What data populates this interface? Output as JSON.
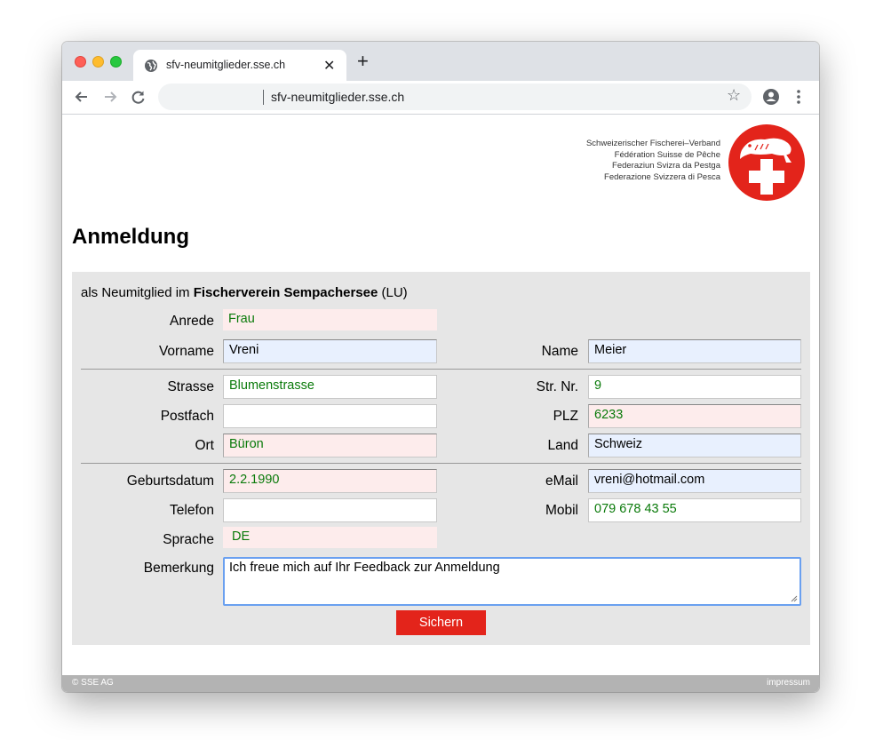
{
  "browser": {
    "tab_title": "sfv-neumitglieder.sse.ch",
    "url": "sfv-neumitglieder.sse.ch",
    "new_tab": "+",
    "close_tab": "✕"
  },
  "brand": {
    "line1": "Schweizerischer Fischerei–Verband",
    "line2": "Fédération Suisse de Pêche",
    "line3": "Federaziun Svizra da Pestga",
    "line4": "Federazione Svizzera di Pesca",
    "logo_color": "#e3241b"
  },
  "page": {
    "title": "Anmeldung",
    "intro_prefix": "als Neumitglied im ",
    "club": "Fischerverein Sempachersee",
    "intro_suffix": " (LU)"
  },
  "form": {
    "anrede_label": "Anrede",
    "anrede_value": "Frau",
    "vorname_label": "Vorname",
    "vorname_value": "Vreni",
    "name_label": "Name",
    "name_value": "Meier",
    "strasse_label": "Strasse",
    "strasse_value": "Blumenstrasse",
    "strnr_label": "Str. Nr.",
    "strnr_value": "9",
    "postfach_label": "Postfach",
    "postfach_value": "",
    "plz_label": "PLZ",
    "plz_value": "6233",
    "ort_label": "Ort",
    "ort_value": "Büron",
    "land_label": "Land",
    "land_value": "Schweiz",
    "geburtsdatum_label": "Geburtsdatum",
    "geburtsdatum_value": "2.2.1990",
    "email_label": "eMail",
    "email_value": "vreni@hotmail.com",
    "telefon_label": "Telefon",
    "telefon_value": "",
    "mobil_label": "Mobil",
    "mobil_value": "079 678 43 55",
    "sprache_label": "Sprache",
    "sprache_value": "DE",
    "bemerkung_label": "Bemerkung",
    "bemerkung_value": "Ich freue mich auf Ihr Feedback zur Anmeldung",
    "save_label": "Sichern"
  },
  "footer": {
    "copyright": "© SSE AG",
    "impressum": "impressum"
  },
  "colors": {
    "accent_red": "#e3241b",
    "panel_bg": "#e6e6e6",
    "required_pink": "#fdecec",
    "autofill_blue": "#e8f0fe",
    "value_green": "#0a7a0a"
  }
}
